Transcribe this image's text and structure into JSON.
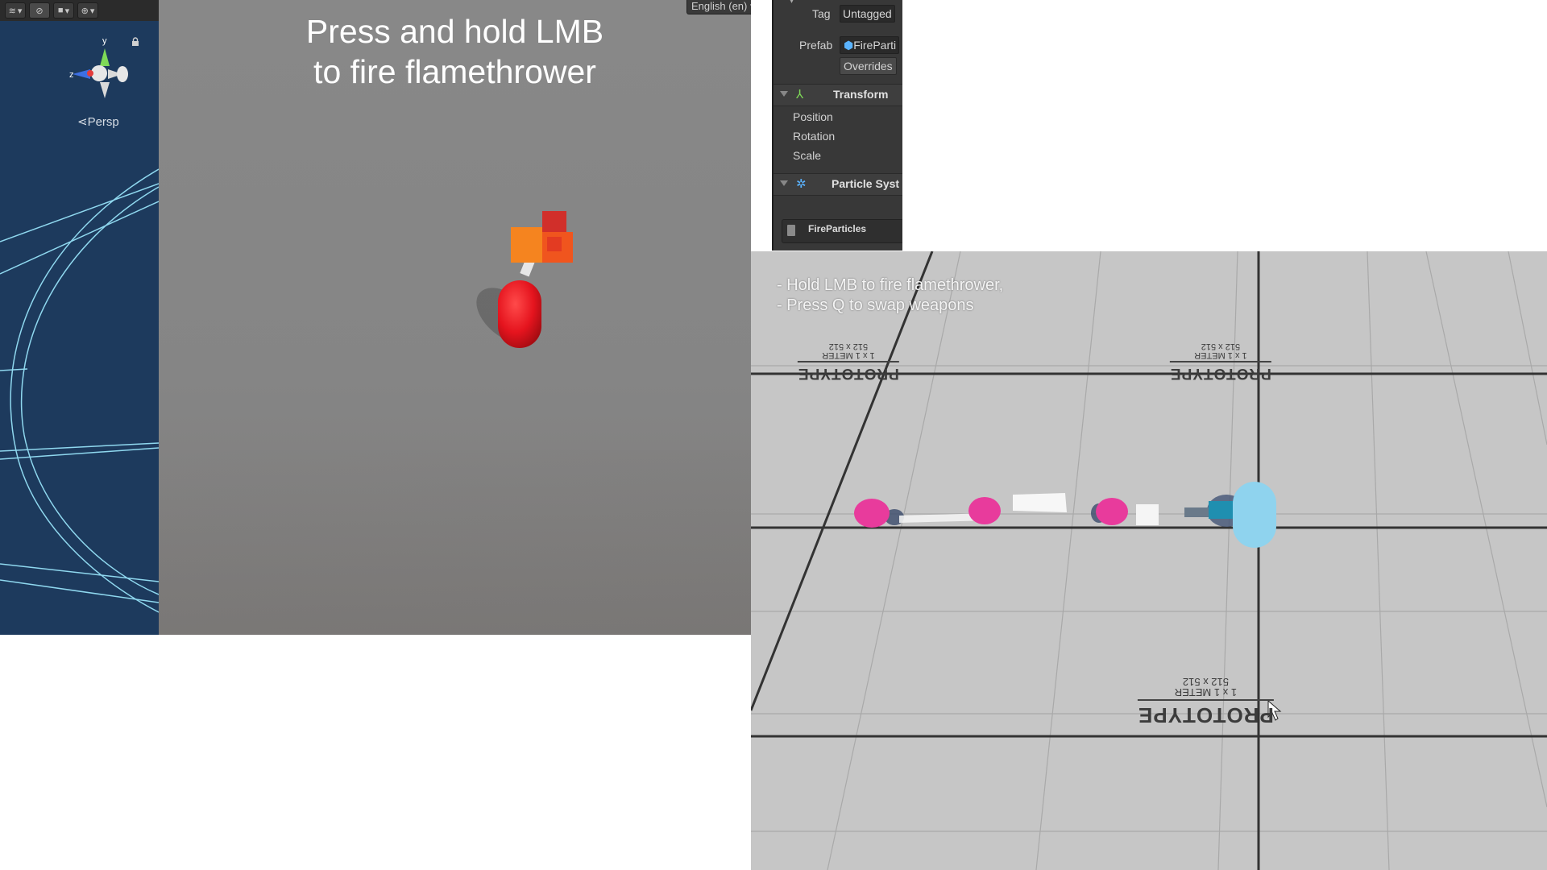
{
  "scene_view": {
    "persp_label": "Persp",
    "axis_labels": {
      "y": "y",
      "z": "z"
    },
    "toolbar_icons": [
      "layers-icon",
      "visibility-icon",
      "camera-icon",
      "gizmo-icon"
    ]
  },
  "game_view": {
    "instruction_line1": "Press and hold LMB",
    "instruction_line2": "to fire flamethrower",
    "language_dropdown": "English (en)"
  },
  "inspector": {
    "tag_label": "Tag",
    "tag_value": "Untagged",
    "prefab_label": "Prefab",
    "prefab_value": "FireParti",
    "overrides_label": "Overrides",
    "transform_title": "Transform",
    "position_label": "Position",
    "rotation_label": "Rotation",
    "scale_label": "Scale",
    "particle_title": "Particle Syst",
    "fire_particles_label": "FireParticles"
  },
  "game_screen": {
    "hint_line1": "- Hold LMB to fire flamethrower,",
    "hint_line2": "- Press Q to swap weapons",
    "proto_tiles": [
      {
        "word": "PROTOTYPE",
        "meter": "1 x 1 METER",
        "size": "512 x 512"
      },
      {
        "word": "PROTOTYPE",
        "meter": "1 x 1 METER",
        "size": "512 x 512"
      },
      {
        "word": "PROTOTYPE",
        "meter": "1 x 1 METER",
        "size": "512 x 512"
      }
    ]
  },
  "colors": {
    "scene_bg": "#1d3a5d",
    "game_view_bg": "#888888",
    "player_red": "#e5141e",
    "flame_orange": "#f5841f",
    "enemy_pink": "#e83b9c",
    "player_blue": "#8fd3ee",
    "floor_grey": "#c6c6c6"
  }
}
